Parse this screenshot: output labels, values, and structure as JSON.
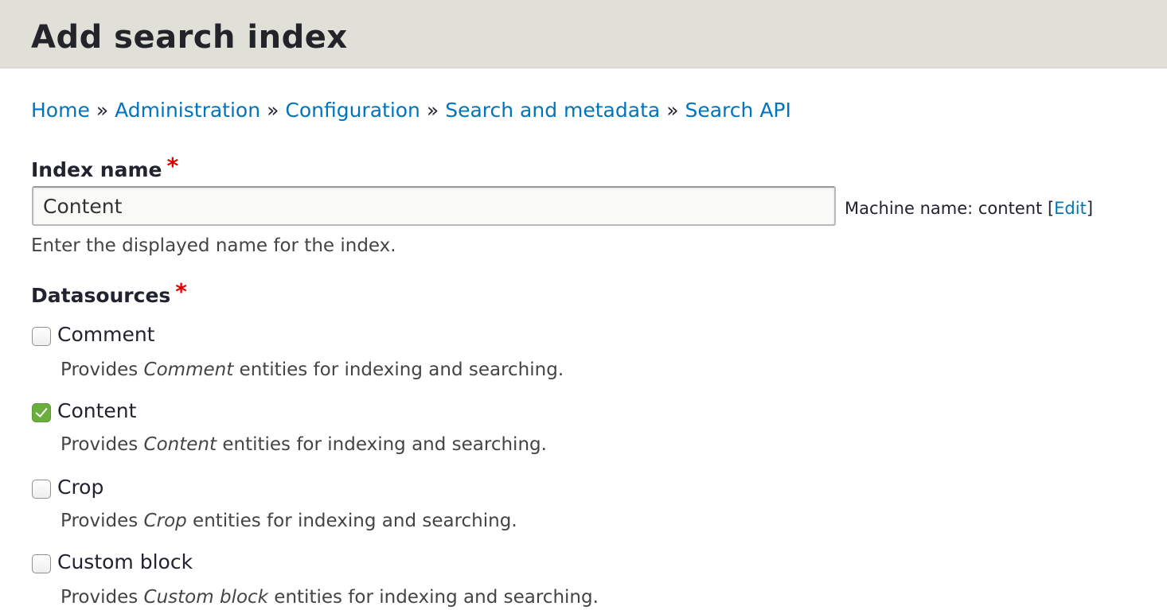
{
  "header": {
    "title": "Add search index"
  },
  "breadcrumb": {
    "items": [
      "Home",
      "Administration",
      "Configuration",
      "Search and metadata",
      "Search API"
    ],
    "separator": "»"
  },
  "index_name": {
    "label": "Index name",
    "required_mark": "*",
    "value": "Content",
    "machine_name_prefix": "Machine name: content [",
    "edit_link": "Edit",
    "machine_name_suffix": "]",
    "description": "Enter the displayed name for the index."
  },
  "datasources": {
    "label": "Datasources",
    "required_mark": "*",
    "desc_prefix": "Provides ",
    "desc_suffix": " entities for indexing and searching.",
    "items": [
      {
        "label": "Comment",
        "entity": "Comment",
        "checked": false
      },
      {
        "label": "Content",
        "entity": "Content",
        "checked": true
      },
      {
        "label": "Crop",
        "entity": "Crop",
        "checked": false
      },
      {
        "label": "Custom block",
        "entity": "Custom block",
        "checked": false
      }
    ]
  },
  "colors": {
    "header_bg": "#e0e0d8",
    "link": "#0074bd",
    "required": "#e00000",
    "checked": "#6aaf3d"
  }
}
